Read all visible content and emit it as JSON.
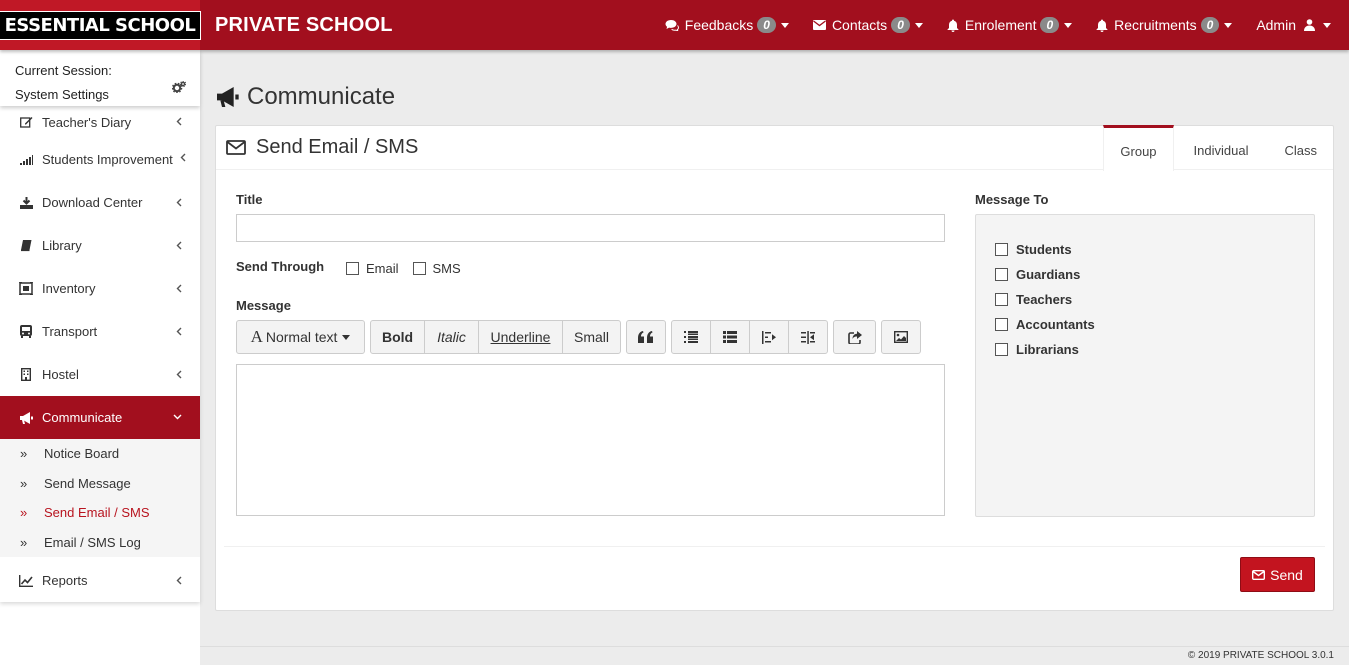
{
  "header": {
    "logo": "ESSENTIAL SCHOOL",
    "brand": "PRIVATE SCHOOL",
    "nav": [
      {
        "label": "Feedbacks",
        "count": "0",
        "icon": "comments-icon"
      },
      {
        "label": "Contacts",
        "count": "0",
        "icon": "envelope-icon"
      },
      {
        "label": "Enrolement",
        "count": "0",
        "icon": "bell-icon"
      },
      {
        "label": "Recruitments",
        "count": "0",
        "icon": "bell-icon"
      }
    ],
    "user": "Admin"
  },
  "sidebar": {
    "session_line1": "Current Session:",
    "session_line2": "System Settings",
    "items": [
      {
        "label": "Teacher's Diary",
        "icon": "edit-icon"
      },
      {
        "label": "Students Improvement",
        "icon": "signal-icon"
      },
      {
        "label": "Download Center",
        "icon": "download-icon"
      },
      {
        "label": "Library",
        "icon": "book-icon"
      },
      {
        "label": "Inventory",
        "icon": "inventory-icon"
      },
      {
        "label": "Transport",
        "icon": "bus-icon"
      },
      {
        "label": "Hostel",
        "icon": "building-icon"
      },
      {
        "label": "Communicate",
        "icon": "bullhorn-icon"
      },
      {
        "label": "Reports",
        "icon": "line-chart-icon"
      }
    ],
    "submenu": [
      {
        "label": "Notice Board"
      },
      {
        "label": "Send Message"
      },
      {
        "label": "Send Email / SMS"
      },
      {
        "label": "Email / SMS Log"
      }
    ]
  },
  "page": {
    "title": "Communicate"
  },
  "panel": {
    "title": "Send Email / SMS",
    "tabs": [
      "Group",
      "Individual",
      "Class"
    ],
    "active_tab": "Group",
    "title_label": "Title",
    "title_value": "",
    "send_through_label": "Send Through",
    "send_options": [
      "Email",
      "SMS"
    ],
    "message_label": "Message",
    "toolbar": {
      "format": "Normal text",
      "bold": "Bold",
      "italic": "Italic",
      "underline": "Underline",
      "small": "Small"
    },
    "message_to_label": "Message To",
    "recipients": [
      "Students",
      "Guardians",
      "Teachers",
      "Accountants",
      "Librarians"
    ],
    "send_label": "Send"
  },
  "footer": {
    "copyright": "© 2019 PRIVATE SCHOOL 3.0.1"
  },
  "colors": {
    "primary": "#a20f1e",
    "logo_bg": "#c01826",
    "send_button": "#c3141f"
  }
}
